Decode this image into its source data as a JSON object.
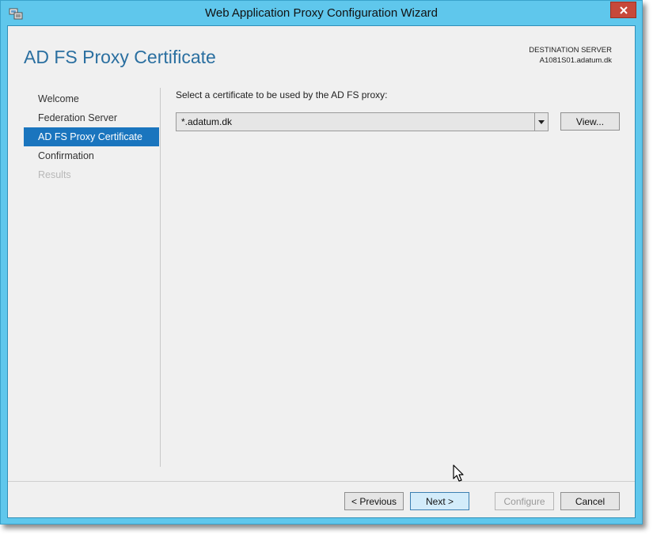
{
  "window": {
    "title": "Web Application Proxy Configuration Wizard",
    "close_icon": "close-icon",
    "app_icon": "server-config-icon"
  },
  "header": {
    "page_title": "AD FS Proxy Certificate",
    "destination_label": "DESTINATION SERVER",
    "destination_value": "A1081S01.adatum.dk"
  },
  "nav": {
    "items": [
      {
        "label": "Welcome",
        "state": "normal"
      },
      {
        "label": "Federation Server",
        "state": "normal"
      },
      {
        "label": "AD FS Proxy Certificate",
        "state": "active"
      },
      {
        "label": "Confirmation",
        "state": "normal"
      },
      {
        "label": "Results",
        "state": "disabled"
      }
    ]
  },
  "main": {
    "prompt": "Select a certificate to be used by the AD FS proxy:",
    "certificate_select": {
      "value": "*.adatum.dk"
    },
    "view_label": "View..."
  },
  "footer": {
    "previous_label": "< Previous",
    "next_label": "Next >",
    "configure_label": "Configure",
    "cancel_label": "Cancel"
  },
  "colors": {
    "window_frame": "#5fc7ec",
    "active_nav": "#1a75be",
    "title_blue": "#2a6fa0",
    "close_button": "#c7493a"
  }
}
